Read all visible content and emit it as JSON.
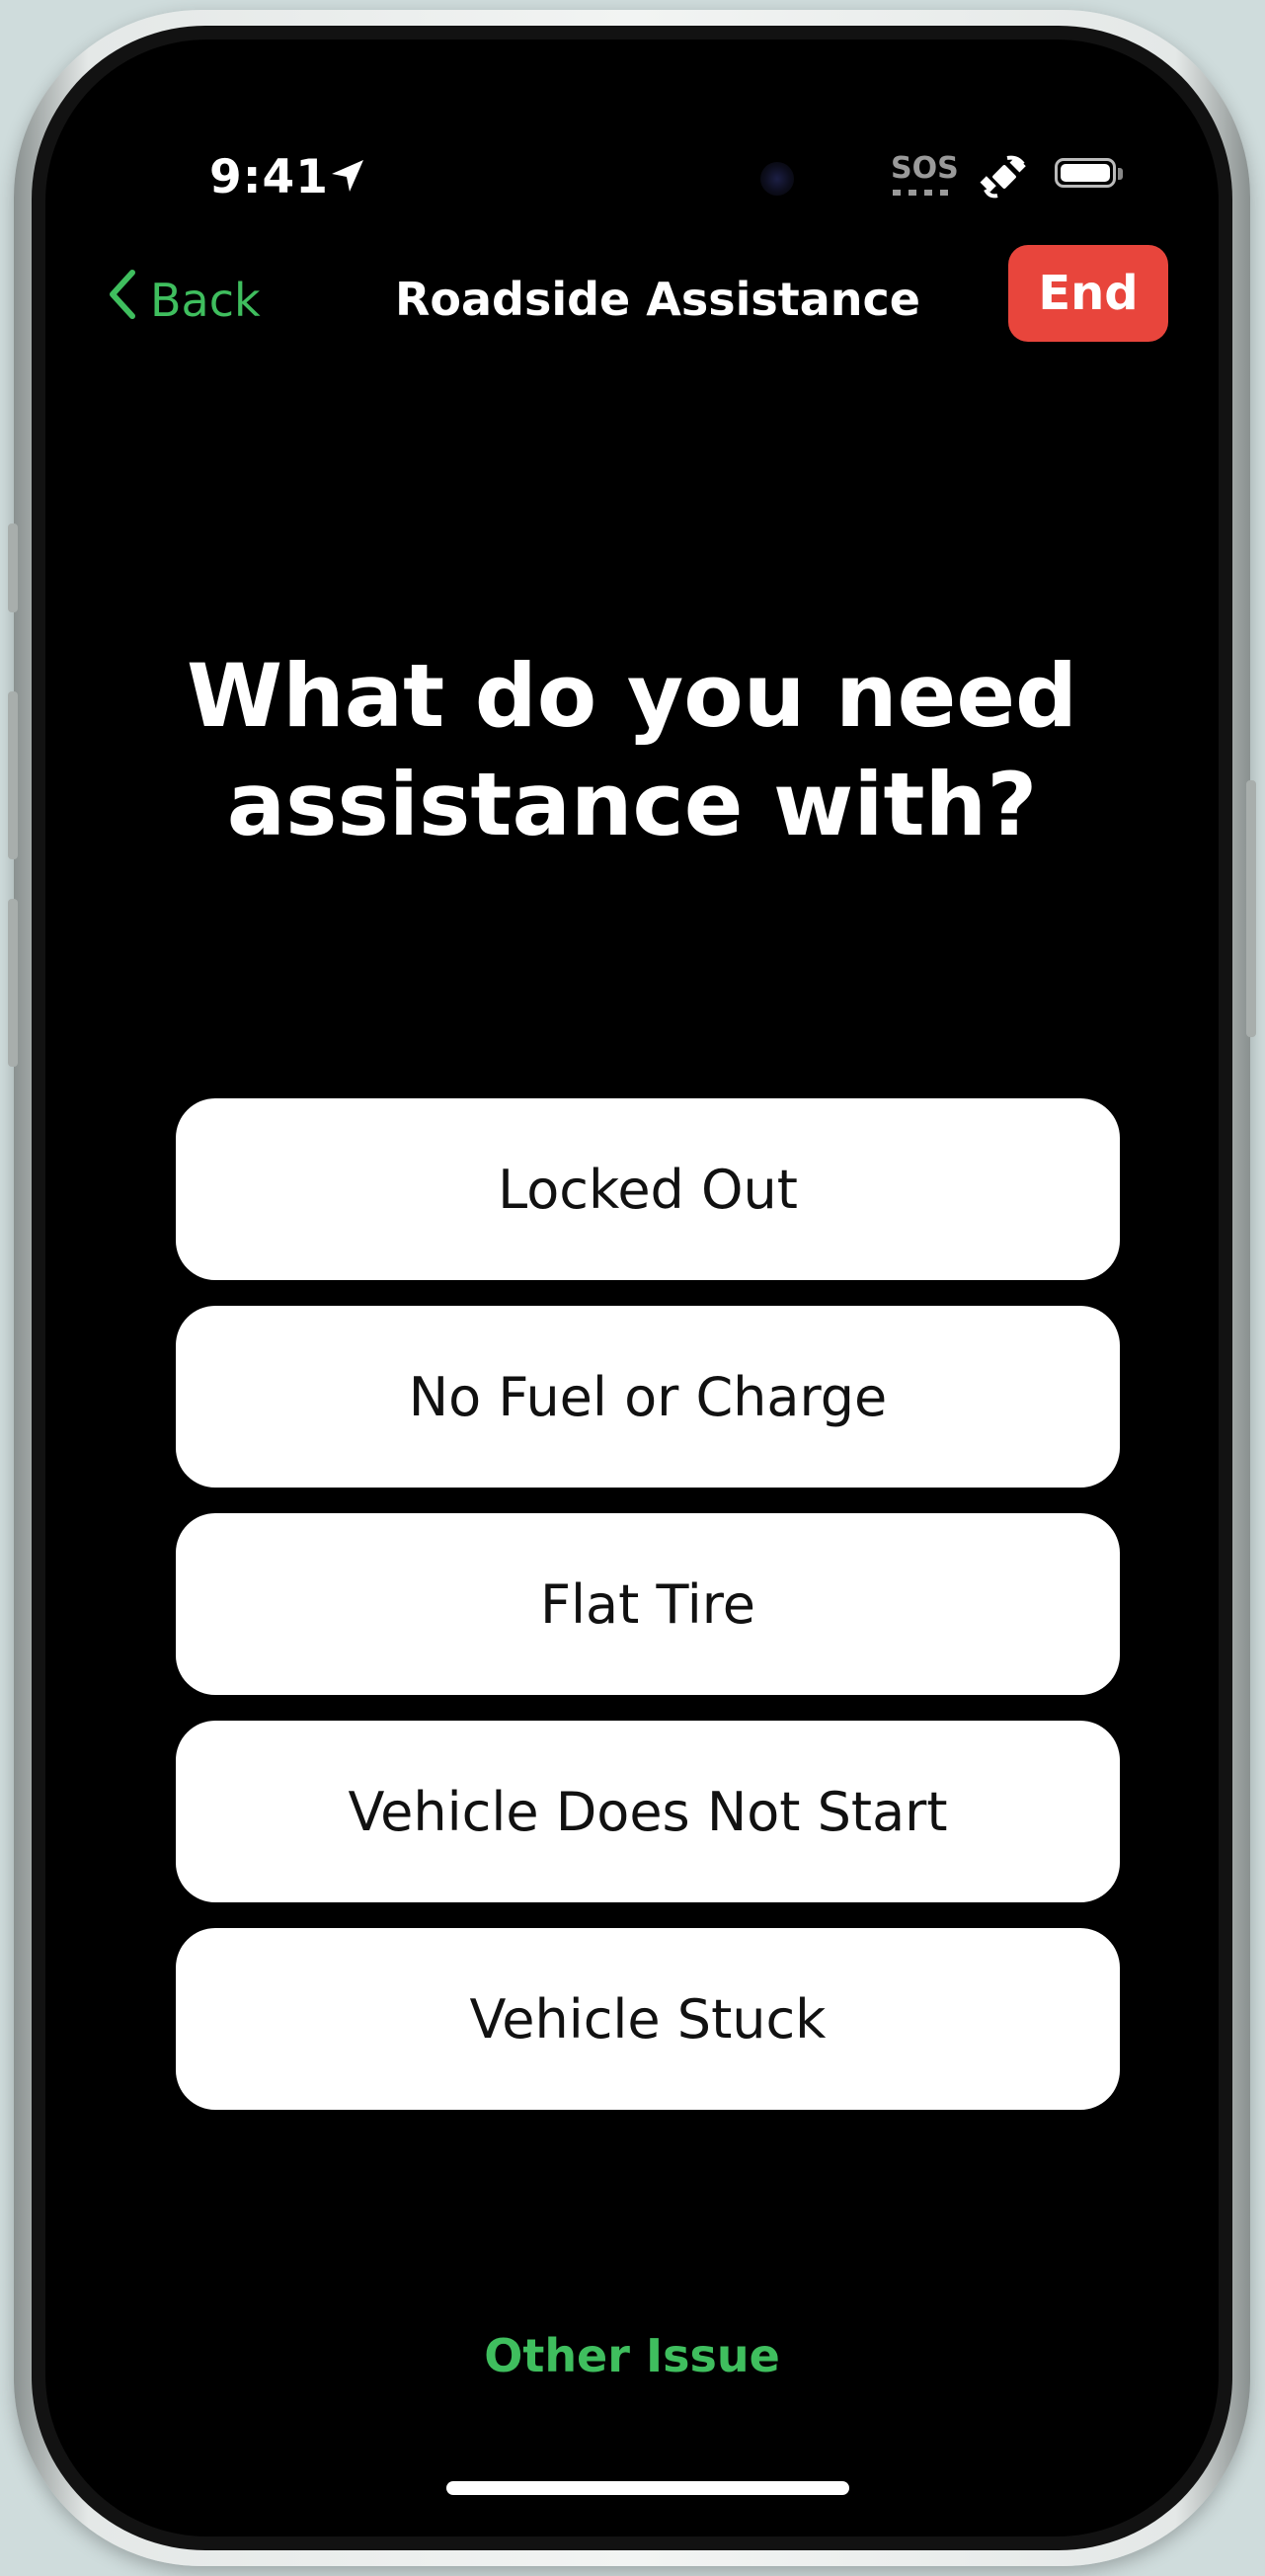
{
  "status_bar": {
    "time": "9:41",
    "sos_label": "SOS",
    "icons": [
      "location-arrow-icon",
      "satellite-icon",
      "battery-icon"
    ]
  },
  "nav": {
    "back_label": "Back",
    "title": "Roadside Assistance",
    "end_label": "End"
  },
  "question": {
    "line1": "What do you need",
    "line2": "assistance with?"
  },
  "options": [
    "Locked Out",
    "No Fuel or Charge",
    "Flat Tire",
    "Vehicle Does Not Start",
    "Vehicle Stuck"
  ],
  "footer": {
    "other_label": "Other Issue"
  },
  "colors": {
    "accent_green": "#3fbe5e",
    "end_red": "#e8453c",
    "background": "#000000"
  }
}
